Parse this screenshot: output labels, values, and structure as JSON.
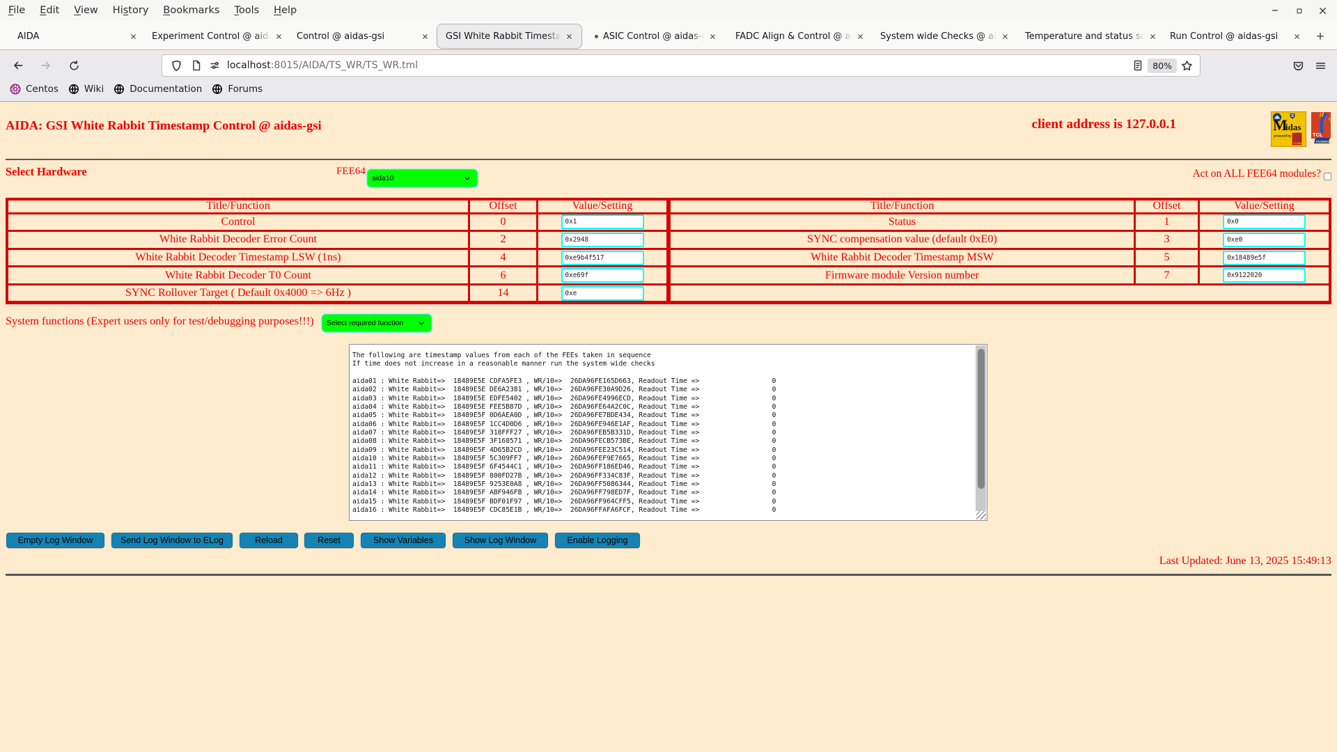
{
  "browser": {
    "menu": [
      {
        "label": "File",
        "accel": "F"
      },
      {
        "label": "Edit",
        "accel": "E"
      },
      {
        "label": "View",
        "accel": "V"
      },
      {
        "label": "History",
        "accel": "s"
      },
      {
        "label": "Bookmarks",
        "accel": "B"
      },
      {
        "label": "Tools",
        "accel": "T"
      },
      {
        "label": "Help",
        "accel": "H"
      }
    ],
    "tabs": [
      {
        "label": "AIDA"
      },
      {
        "label": "Experiment Control @ aidas"
      },
      {
        "label": "Control @ aidas-gsi"
      },
      {
        "label": "GSI White Rabbit Timestam"
      },
      {
        "label": "ASIC Control @ aidas-g"
      },
      {
        "label": "FADC Align & Control @ ai"
      },
      {
        "label": "System wide Checks @ aid"
      },
      {
        "label": "Temperature and status sca"
      },
      {
        "label": "Run Control @ aidas-gsi"
      }
    ],
    "url_host": "localhost",
    "url_path": ":8015/AIDA/TS_WR/TS_WR.tml",
    "zoom_level": "80%",
    "bookmarks": [
      "Centos",
      "Wiki",
      "Documentation",
      "Forums"
    ]
  },
  "page": {
    "title": "AIDA: GSI White Rabbit Timestamp Control @ aidas-gsi",
    "client_address": "client address is 127.0.0.1",
    "select_hardware_label": "Select Hardware",
    "fee64_label": "FEE64",
    "fee64_selected": "aida10",
    "act_on_all_label": "Act on ALL FEE64 modules?",
    "table": {
      "header_title": "Title/Function",
      "header_offset": "Offset",
      "header_value": "Value/Setting",
      "left": [
        {
          "title": "Control",
          "offset": "0",
          "value": "0x1"
        },
        {
          "title": "White Rabbit Decoder Error Count",
          "offset": "2",
          "value": "0x2948"
        },
        {
          "title": "White Rabbit Decoder Timestamp LSW (1ns)",
          "offset": "4",
          "value": "0xe9b4f517"
        },
        {
          "title": "White Rabbit Decoder T0 Count",
          "offset": "6",
          "value": "0xe69f"
        },
        {
          "title": "SYNC Rollover Target ( Default 0x4000 => 6Hz )",
          "offset": "14",
          "value": "0xe"
        }
      ],
      "right": [
        {
          "title": "Status",
          "offset": "1",
          "value": "0x0"
        },
        {
          "title": "SYNC compensation value (default 0xE0)",
          "offset": "3",
          "value": "0xe0"
        },
        {
          "title": "White Rabbit Decoder Timestamp MSW",
          "offset": "5",
          "value": "0x18489e5f"
        },
        {
          "title": "Firmware module Version number",
          "offset": "7",
          "value": "0x9122020"
        }
      ]
    },
    "system_functions_label": "System functions (Expert users only for test/debugging purposes!!!)",
    "system_functions_selected": "Select required function",
    "log_text": "The following are timestamp values from each of the FEEs taken in sequence\nIf time does not increase in a reasonable manner run the system wide checks\n\naida01 : White Rabbit=>  18489E5E CDFA5FE3 , WR/10=>  26DA96FE165D663, Readout Time =>                  0\naida02 : White Rabbit=>  18489E5E DE6A2381 , WR/10=>  26DA96FE30A9D26, Readout Time =>                  0\naida03 : White Rabbit=>  18489E5E EDFE5402 , WR/10=>  26DA96FE4996ECD, Readout Time =>                  0\naida04 : White Rabbit=>  18489E5E FEE5B87D , WR/10=>  26DA96FE64A2C0C, Readout Time =>                  0\naida05 : White Rabbit=>  18489E5F 0D6AEA0D , WR/10=>  26DA96FE7BDE434, Readout Time =>                  0\naida06 : White Rabbit=>  18489E5F 1CC4D0D6 , WR/10=>  26DA96FE946E1AF, Readout Time =>                  0\naida07 : White Rabbit=>  18489E5F 318FFF27 , WR/10=>  26DA96FEB5B331D, Readout Time =>                  0\naida08 : White Rabbit=>  18489E5F 3F168571 , WR/10=>  26DA96FECB573BE, Readout Time =>                  0\naida09 : White Rabbit=>  18489E5F 4D65B2CD , WR/10=>  26DA96FEE23C514, Readout Time =>                  0\naida10 : White Rabbit=>  18489E5F 5C309FF7 , WR/10=>  26DA96FEF9E7665, Readout Time =>                  0\naida11 : White Rabbit=>  18489E5F 6F4544C1 , WR/10=>  26DA96FF186ED46, Readout Time =>                  0\naida12 : White Rabbit=>  18489E5F 800FD27B , WR/10=>  26DA96FF334C83F, Readout Time =>                  0\naida13 : White Rabbit=>  18489E5F 9253E0A8 , WR/10=>  26DA96FF5086344, Readout Time =>                  0\naida14 : White Rabbit=>  18489E5F ABF946FB , WR/10=>  26DA96FF798ED7F, Readout Time =>                  0\naida15 : White Rabbit=>  18489E5F BDF01F97 , WR/10=>  26DA96FF964CFF5, Readout Time =>                  0\naida16 : White Rabbit=>  18489E5F CDC85E1B , WR/10=>  26DA96FFAFA6FCF, Readout Time =>                  0\n",
    "buttons": [
      "Empty Log Window",
      "Send Log Window to ELog",
      "Reload",
      "Reset",
      "Show Variables",
      "Show Log Window",
      "Enable Logging"
    ],
    "last_updated": "Last Updated: June 13, 2025 15:49:13"
  }
}
